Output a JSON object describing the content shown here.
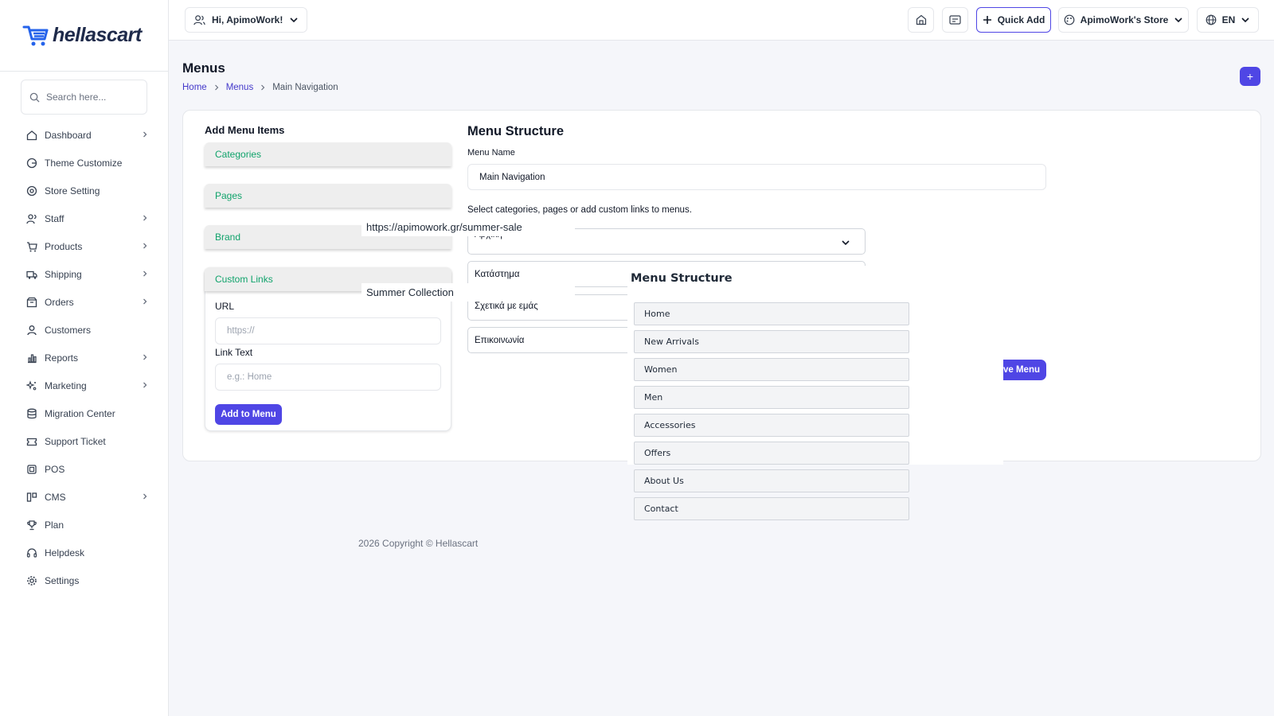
{
  "brand": {
    "name": "hellascart",
    "accent": "#4f46e5",
    "link_green": "#10a36b"
  },
  "sidebar": {
    "search_placeholder": "Search here...",
    "items": [
      {
        "label": "Dashboard",
        "icon": "home-icon",
        "has_children": true
      },
      {
        "label": "Theme Customize",
        "icon": "palette-icon",
        "has_children": false
      },
      {
        "label": "Store Setting",
        "icon": "store-settings-icon",
        "has_children": false
      },
      {
        "label": "Staff",
        "icon": "users-icon",
        "has_children": true
      },
      {
        "label": "Products",
        "icon": "cart-icon",
        "has_children": true
      },
      {
        "label": "Shipping",
        "icon": "truck-icon",
        "has_children": true
      },
      {
        "label": "Orders",
        "icon": "box-icon",
        "has_children": true
      },
      {
        "label": "Customers",
        "icon": "user-icon",
        "has_children": false
      },
      {
        "label": "Reports",
        "icon": "chart-icon",
        "has_children": true
      },
      {
        "label": "Marketing",
        "icon": "sparkle-icon",
        "has_children": true
      },
      {
        "label": "Migration Center",
        "icon": "database-icon",
        "has_children": false
      },
      {
        "label": "Support Ticket",
        "icon": "ticket-icon",
        "has_children": false
      },
      {
        "label": "POS",
        "icon": "pos-icon",
        "has_children": false
      },
      {
        "label": "CMS",
        "icon": "layout-icon",
        "has_children": true
      },
      {
        "label": "Plan",
        "icon": "trophy-icon",
        "has_children": false
      },
      {
        "label": "Helpdesk",
        "icon": "headset-icon",
        "has_children": false
      },
      {
        "label": "Settings",
        "icon": "gear-icon",
        "has_children": false
      }
    ]
  },
  "topbar": {
    "greeting": "Hi, ApimoWork!",
    "quick_add": "Quick Add",
    "store": "ApimoWork's Store",
    "language": "EN"
  },
  "page": {
    "title": "Menus",
    "breadcrumb": [
      "Home",
      "Menus",
      "Main Navigation"
    ],
    "fab_label": "+"
  },
  "add_items": {
    "title": "Add Menu Items",
    "sections": [
      "Categories",
      "Pages",
      "Brand",
      "Custom Links"
    ],
    "url_label": "URL",
    "url_placeholder": "https://",
    "link_text_label": "Link Text",
    "link_text_placeholder": "e.g.: Home",
    "add_button": "Add to Menu"
  },
  "structure": {
    "title": "Menu Structure",
    "menu_name_label": "Menu Name",
    "menu_name_value": "Main Navigation",
    "hint": "Select categories, pages or add custom links to menus.",
    "selects": [
      "Αρχική",
      "Κατάστημα",
      "Σχετικά με εμάς",
      "Επικοινωνία"
    ],
    "save_button": "ve Menu"
  },
  "floating": {
    "url_text": "https://apimowork.gr/summer-sale",
    "link_text": "Summer Collection"
  },
  "overlay": {
    "title": "Menu Structure",
    "items": [
      "Home",
      "New Arrivals",
      "Women",
      "Men",
      "Accessories",
      "Offers",
      "About Us",
      "Contact"
    ]
  },
  "footer": {
    "text": "2026 Copyright © Hellascart"
  }
}
